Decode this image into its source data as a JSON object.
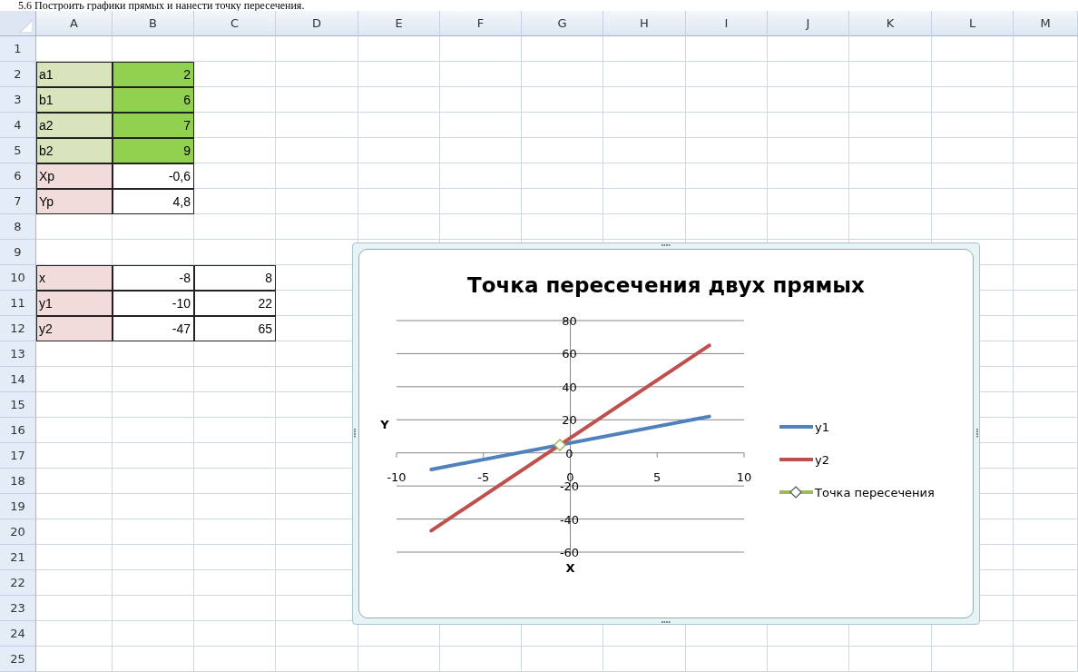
{
  "caption": "5.6 Построить графики прямых и нанести точку пересечения.",
  "sheet": {
    "columns": [
      "A",
      "B",
      "C",
      "D",
      "E",
      "F",
      "G",
      "H",
      "I",
      "J",
      "K",
      "L",
      "M"
    ],
    "rows": [
      {
        "number": "1",
        "cells": []
      },
      {
        "number": "2",
        "cells": [
          {
            "text": "a1",
            "kind": "label",
            "color": "#d8e4bc"
          },
          {
            "text": "2",
            "kind": "number",
            "color": "#92d050"
          }
        ]
      },
      {
        "number": "3",
        "cells": [
          {
            "text": "b1",
            "kind": "label",
            "color": "#d8e4bc"
          },
          {
            "text": "6",
            "kind": "number",
            "color": "#92d050"
          }
        ]
      },
      {
        "number": "4",
        "cells": [
          {
            "text": "a2",
            "kind": "label",
            "color": "#d8e4bc"
          },
          {
            "text": "7",
            "kind": "number",
            "color": "#92d050"
          }
        ]
      },
      {
        "number": "5",
        "cells": [
          {
            "text": "b2",
            "kind": "label",
            "color": "#d8e4bc"
          },
          {
            "text": "9",
            "kind": "number",
            "color": "#92d050"
          }
        ]
      },
      {
        "number": "6",
        "cells": [
          {
            "text": "Xp",
            "kind": "label",
            "color": "#f2dcdb"
          },
          {
            "text": "-0,6",
            "kind": "number",
            "color": "#ffffff"
          }
        ]
      },
      {
        "number": "7",
        "cells": [
          {
            "text": "Yp",
            "kind": "label",
            "color": "#f2dcdb"
          },
          {
            "text": "4,8",
            "kind": "number",
            "color": "#ffffff"
          }
        ]
      },
      {
        "number": "8",
        "cells": []
      },
      {
        "number": "9",
        "cells": []
      },
      {
        "number": "10",
        "cells": [
          {
            "text": "x",
            "kind": "label",
            "color": "#f2dcdb"
          },
          {
            "text": "-8",
            "kind": "number",
            "color": "#ffffff"
          },
          {
            "text": "8",
            "kind": "number",
            "color": "#ffffff"
          }
        ]
      },
      {
        "number": "11",
        "cells": [
          {
            "text": "y1",
            "kind": "label",
            "color": "#f2dcdb"
          },
          {
            "text": "-10",
            "kind": "number",
            "color": "#ffffff"
          },
          {
            "text": "22",
            "kind": "number",
            "color": "#ffffff"
          }
        ]
      },
      {
        "number": "12",
        "cells": [
          {
            "text": "y2",
            "kind": "label",
            "color": "#f2dcdb"
          },
          {
            "text": "-47",
            "kind": "number",
            "color": "#ffffff"
          },
          {
            "text": "65",
            "kind": "number",
            "color": "#ffffff"
          }
        ]
      },
      {
        "number": "13",
        "cells": []
      },
      {
        "number": "14",
        "cells": []
      },
      {
        "number": "15",
        "cells": []
      },
      {
        "number": "16",
        "cells": []
      },
      {
        "number": "17",
        "cells": []
      },
      {
        "number": "18",
        "cells": []
      },
      {
        "number": "19",
        "cells": []
      },
      {
        "number": "20",
        "cells": []
      },
      {
        "number": "21",
        "cells": []
      },
      {
        "number": "22",
        "cells": []
      },
      {
        "number": "23",
        "cells": []
      },
      {
        "number": "24",
        "cells": []
      },
      {
        "number": "25",
        "cells": []
      }
    ]
  },
  "chart": {
    "chart_data": {
      "type": "scatter",
      "title": "Точка пересечения двух прямых",
      "xlabel": "X",
      "ylabel": "Y",
      "xlim": [
        -10,
        10
      ],
      "ylim": [
        -60,
        80
      ],
      "xticks": [
        {
          "value": -10,
          "label": "-10"
        },
        {
          "value": -5,
          "label": "-5"
        },
        {
          "value": 0,
          "label": "0"
        },
        {
          "value": 5,
          "label": "5"
        },
        {
          "value": 10,
          "label": "10"
        }
      ],
      "yticks": [
        {
          "value": -60,
          "label": "-60"
        },
        {
          "value": -40,
          "label": "-40"
        },
        {
          "value": -20,
          "label": "-20"
        },
        {
          "value": 0,
          "label": "0"
        },
        {
          "value": 20,
          "label": "20"
        },
        {
          "value": 40,
          "label": "40"
        },
        {
          "value": 60,
          "label": "60"
        },
        {
          "value": 80,
          "label": "80"
        }
      ],
      "grid": true,
      "legend": true,
      "series": [
        {
          "name": "y1",
          "color": "#4f81bd",
          "x": [
            -8,
            8
          ],
          "values": [
            -10,
            22
          ],
          "type": "line"
        },
        {
          "name": "y2",
          "color": "#c0504d",
          "x": [
            -8,
            8
          ],
          "values": [
            -47,
            65
          ],
          "type": "line"
        },
        {
          "name": "Точка пересечения",
          "color": "#9bbb59",
          "x": [
            -0.6
          ],
          "values": [
            4.8
          ],
          "type": "scatter"
        }
      ]
    }
  }
}
